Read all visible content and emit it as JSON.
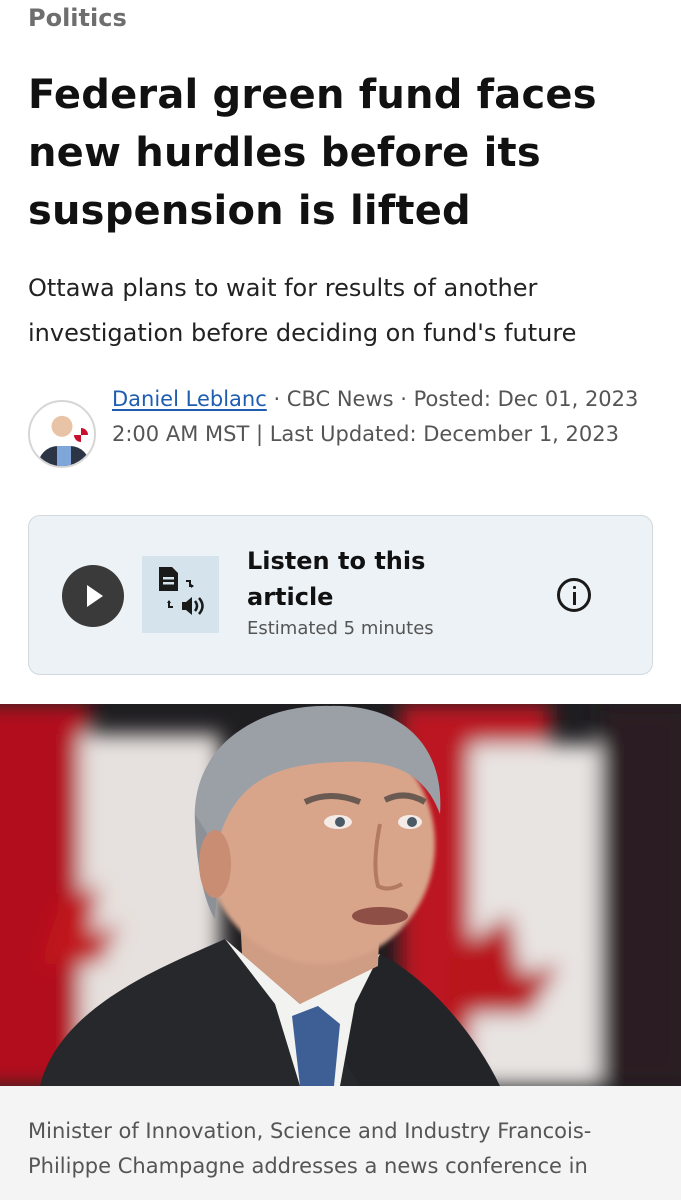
{
  "article": {
    "section": "Politics",
    "headline": "Federal green fund faces new hurdles before its suspension is lifted",
    "dek": "Ottawa plans to wait for results of another investigation before deciding on fund's future",
    "byline": {
      "author": "Daniel Leblanc",
      "separator_1": " · ",
      "outlet": "CBC News",
      "separator_2": " · ",
      "posted_label": "Posted: Dec 01, 2023 2:00 AM MST | Last Updated: December 1, 2023"
    },
    "audio": {
      "title": "Listen to this article",
      "estimate": "Estimated 5 minutes"
    },
    "caption": "Minister of Innovation, Science and Industry Francois-Philippe Champagne addresses a news conference in"
  },
  "icons": {
    "play": "play-icon",
    "text_to_speech": "text-to-speech-icon",
    "info": "info-icon"
  },
  "colors": {
    "link": "#1e5db0",
    "card_bg": "#ecf2f6",
    "flag_red": "#c8102e"
  }
}
